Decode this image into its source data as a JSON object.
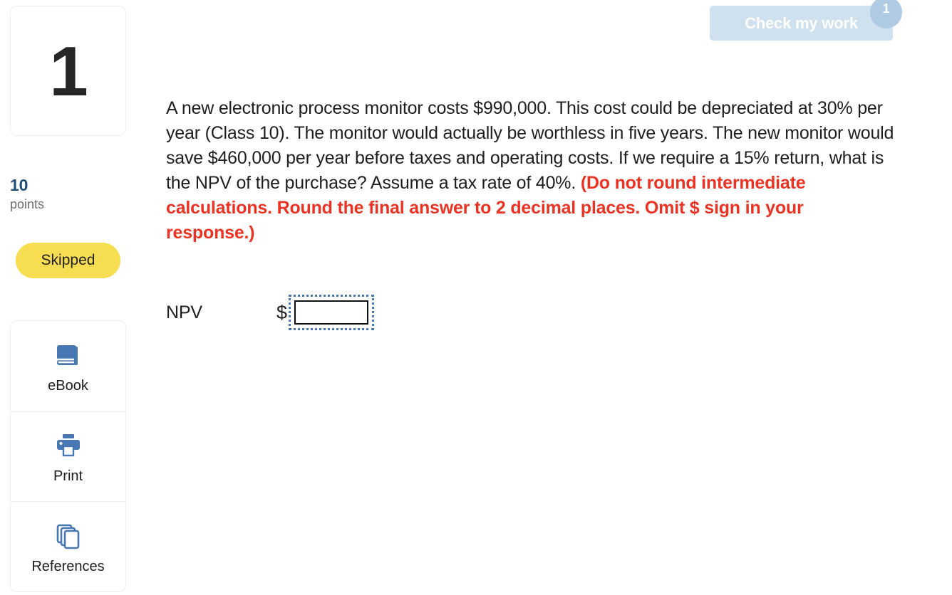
{
  "question": {
    "number": "1",
    "points_value": "10",
    "points_label": "points",
    "status": "Skipped",
    "body_part1": "A new electronic process monitor costs $990,000. This cost could be depreciated at 30% per year (Class 10). The monitor would actually be worthless in five years. The new monitor would save $460,000 per year before taxes and operating costs. If we require a 15% return, what is the NPV of the purchase? Assume a tax rate of 40%. ",
    "body_emphasis": "(Do not round intermediate calculations. Round the final answer to 2 decimal places. Omit $ sign in your response.)"
  },
  "toolbar": {
    "check_label": "Check my work",
    "check_badge": "1"
  },
  "tools": [
    {
      "label": "eBook",
      "icon": "book-icon"
    },
    {
      "label": "Print",
      "icon": "printer-icon"
    },
    {
      "label": "References",
      "icon": "pages-stack-icon"
    }
  ],
  "answer": {
    "label": "NPV",
    "currency": "$",
    "value": "",
    "placeholder": ""
  },
  "colors": {
    "accent_blue": "#4878b4",
    "points_blue": "#1f4e79",
    "emphasis_red": "#ea3323",
    "status_yellow": "#f7dd51",
    "check_button_bg": "#cfe0ef",
    "badge_bg": "#aecbe3"
  }
}
